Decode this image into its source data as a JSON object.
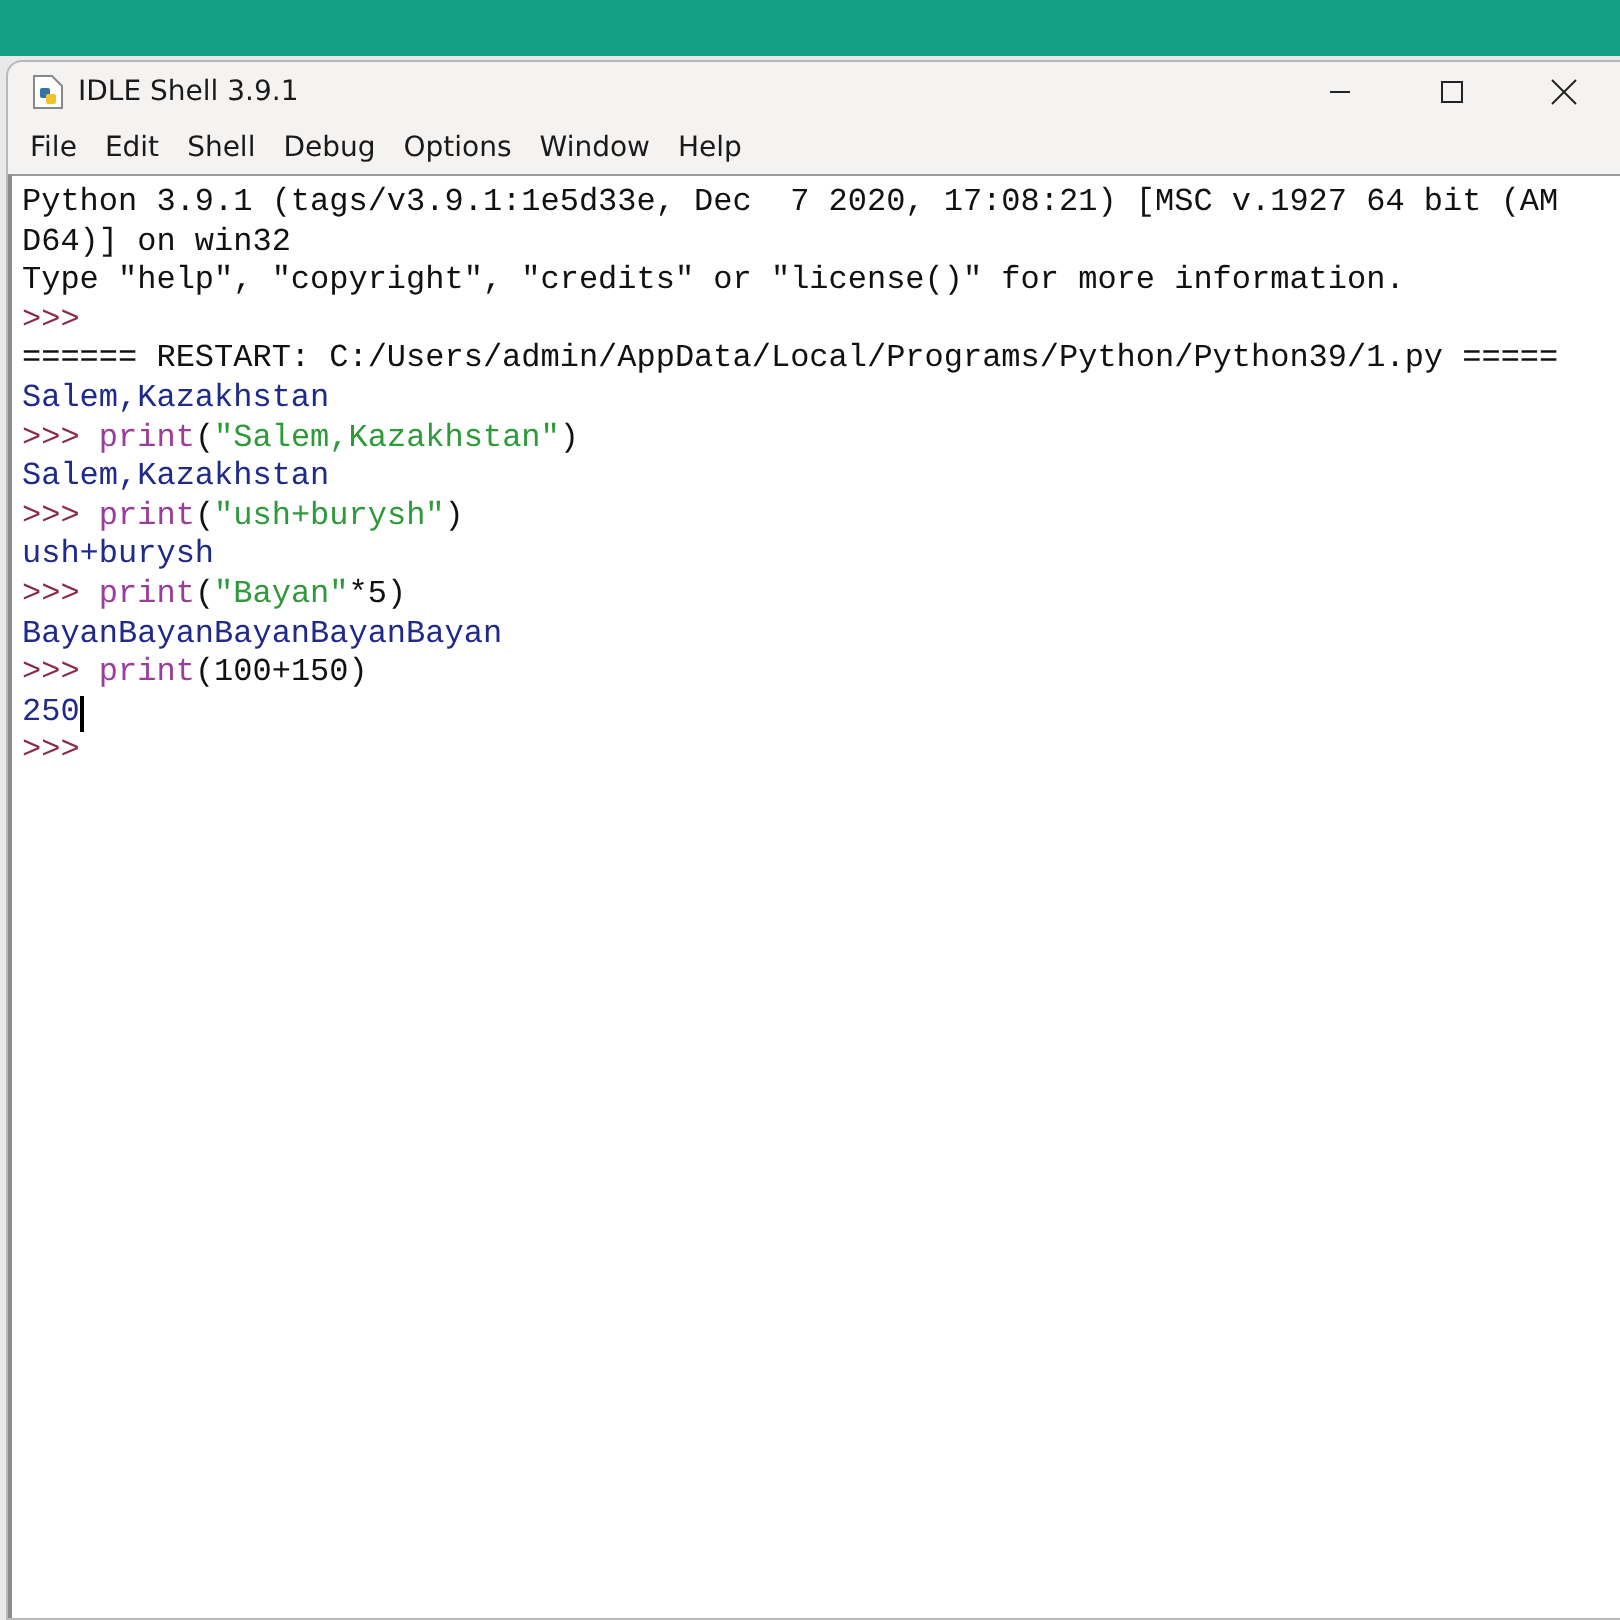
{
  "window": {
    "title": "IDLE Shell 3.9.1"
  },
  "menu": [
    "File",
    "Edit",
    "Shell",
    "Debug",
    "Options",
    "Window",
    "Help"
  ],
  "lines": [
    {
      "segments": [
        {
          "kind": "plain",
          "text": "Python 3.9.1 (tags/v3.9.1:1e5d33e, Dec  7 2020, 17:08:21) [MSC v.1927 64 bit (AM"
        }
      ]
    },
    {
      "segments": [
        {
          "kind": "plain",
          "text": "D64)] on win32"
        }
      ]
    },
    {
      "segments": [
        {
          "kind": "plain",
          "text": "Type \"help\", \"copyright\", \"credits\" or \"license()\" for more information."
        }
      ]
    },
    {
      "segments": [
        {
          "kind": "prompt",
          "text": ">>>"
        }
      ]
    },
    {
      "segments": [
        {
          "kind": "plain",
          "text": "====== RESTART: C:/Users/admin/AppData/Local/Programs/Python/Python39/1.py ====="
        }
      ]
    },
    {
      "segments": [
        {
          "kind": "output",
          "text": "Salem,Kazakhstan"
        }
      ]
    },
    {
      "segments": [
        {
          "kind": "prompt",
          "text": ">>>"
        },
        {
          "kind": "builtin",
          "text": "print"
        },
        {
          "kind": "plain",
          "text": "("
        },
        {
          "kind": "string",
          "text": "\"Salem,Kazakhstan\""
        },
        {
          "kind": "plain",
          "text": ")"
        }
      ]
    },
    {
      "segments": [
        {
          "kind": "output",
          "text": "Salem,Kazakhstan"
        }
      ]
    },
    {
      "segments": [
        {
          "kind": "prompt",
          "text": ">>>"
        },
        {
          "kind": "builtin",
          "text": "print"
        },
        {
          "kind": "plain",
          "text": "("
        },
        {
          "kind": "string",
          "text": "\"ush+burysh\""
        },
        {
          "kind": "plain",
          "text": ")"
        }
      ]
    },
    {
      "segments": [
        {
          "kind": "output",
          "text": "ush+burysh"
        }
      ]
    },
    {
      "segments": [
        {
          "kind": "prompt",
          "text": ">>>"
        },
        {
          "kind": "builtin",
          "text": "print"
        },
        {
          "kind": "plain",
          "text": "("
        },
        {
          "kind": "string",
          "text": "\"Bayan\""
        },
        {
          "kind": "plain",
          "text": "*5)"
        }
      ]
    },
    {
      "segments": [
        {
          "kind": "output",
          "text": "BayanBayanBayanBayanBayan"
        }
      ]
    },
    {
      "segments": [
        {
          "kind": "prompt",
          "text": ">>>"
        },
        {
          "kind": "builtin",
          "text": "print"
        },
        {
          "kind": "plain",
          "text": "(100+150)"
        }
      ]
    },
    {
      "segments": [
        {
          "kind": "output",
          "text": "250"
        }
      ],
      "cursor": true
    },
    {
      "segments": [
        {
          "kind": "prompt",
          "text": ">>>"
        }
      ]
    }
  ]
}
